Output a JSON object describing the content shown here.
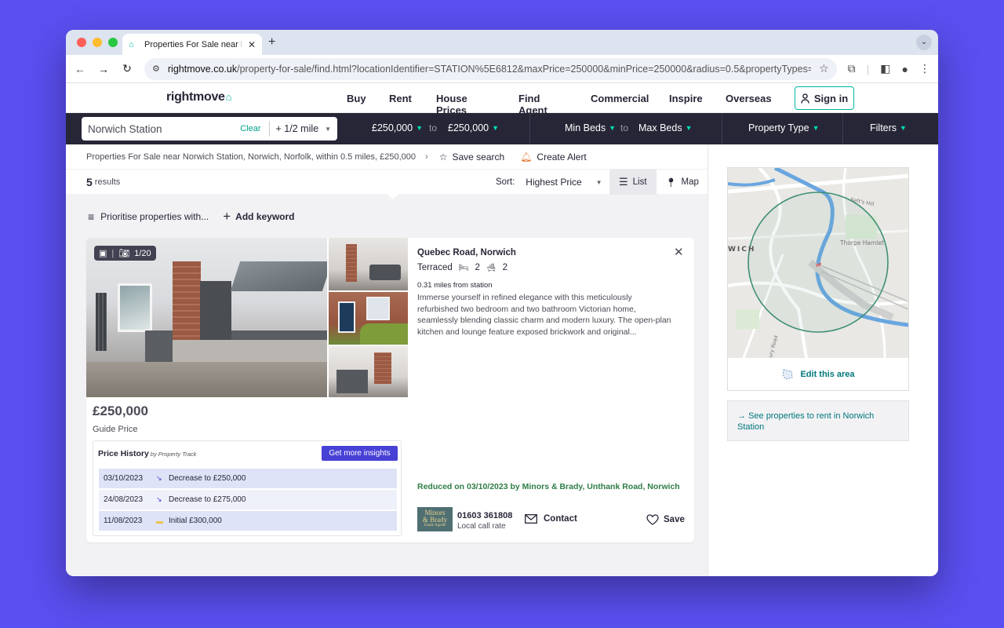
{
  "browser": {
    "tab_title": "Properties For Sale near Nor",
    "url_domain": "rightmove.co.uk",
    "url_rest": "/property-for-sale/find.html?locationIdentifier=STATION%5E6812&maxPrice=250000&minPrice=250000&radius=0.5&propertyTypes=&includeS..."
  },
  "site": {
    "logo": "rightmove",
    "nav": [
      "Buy",
      "Rent",
      "House Prices",
      "Find Agent",
      "Commercial",
      "Inspire",
      "Overseas"
    ],
    "sign_in": "Sign in"
  },
  "search": {
    "location": "Norwich Station",
    "clear": "Clear",
    "radius": "+ 1/2 mile",
    "min_price": "£250,000",
    "max_price": "£250,000",
    "to": "to",
    "min_beds": "Min Beds",
    "max_beds": "Max Beds",
    "property_type": "Property Type",
    "filters": "Filters"
  },
  "breadcrumb": {
    "text": "Properties For Sale near Norwich Station, Norwich, Norfolk, within 0.5 miles, £250,000",
    "save_search": "Save search",
    "create_alert": "Create Alert"
  },
  "results": {
    "count": "5",
    "label": "results",
    "sort_label": "Sort:",
    "sort_value": "Highest Price",
    "list": "List",
    "map": "Map"
  },
  "prioritise": {
    "label": "Prioritise properties with...",
    "add_keyword": "Add keyword"
  },
  "listing": {
    "photo_count": "1/20",
    "price": "£250,000",
    "price_qualifier": "Guide Price",
    "price_history_title": "Price History",
    "price_history_by": "by Property Track",
    "insights_button": "Get more insights",
    "history": [
      {
        "date": "03/10/2023",
        "event": "Decrease to £250,000",
        "icon": "↘"
      },
      {
        "date": "24/08/2023",
        "event": "Decrease to £275,000",
        "icon": "↘"
      },
      {
        "date": "11/08/2023",
        "event": "Initial £300,000",
        "icon": "▬"
      }
    ],
    "address": "Quebec Road, Norwich",
    "type": "Terraced",
    "bedrooms": "2",
    "bathrooms": "2",
    "distance": "0.31 miles from station",
    "description": "Immerse yourself in refined elegance with this meticulously refurbished two bedroom and two bathroom Victorian home, seamlessly blending classic charm and modern luxury. The open-plan kitchen and lounge feature exposed brickwork and original...",
    "reduced": "Reduced on 03/10/2023 by Minors & Brady, Unthank Road, Norwich",
    "agent_logo_line1": "Minors",
    "agent_logo_line2": "& Brady",
    "agent_logo_sub": "Estate Agents",
    "phone": "01603 361808",
    "call_rate": "Local call rate",
    "contact": "Contact",
    "save": "Save"
  },
  "map": {
    "label_wich": "WICH",
    "label_thorpe": "Thorpe Hamlet",
    "label_kett": "Kett's Hill",
    "label_road": "ury Road",
    "edit_area": "Edit this area",
    "rent_link": "See properties to rent in Norwich Station"
  },
  "colors": {
    "brand_teal": "#00deb6",
    "nav_dark": "#262637",
    "insights_purple": "#4841d6",
    "reduced_green": "#2e7d45"
  }
}
